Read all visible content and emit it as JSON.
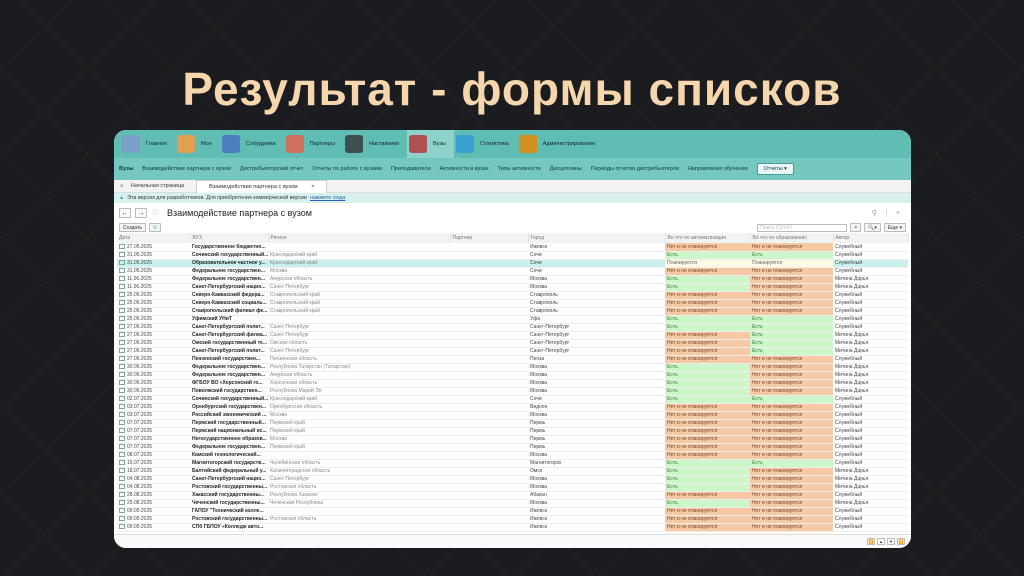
{
  "slide_title": "Результат - формы списков",
  "nav1": [
    {
      "label": "Главное",
      "color": "#7aa0c8"
    },
    {
      "label": "Мое",
      "color": "#e0a050"
    },
    {
      "label": "Сотрудники",
      "color": "#4a7fc0"
    },
    {
      "label": "Партнеры",
      "color": "#d07060"
    },
    {
      "label": "Наставники",
      "color": "#405050"
    },
    {
      "label": "Вузы",
      "color": "#b05050",
      "active": true
    },
    {
      "label": "Статистика",
      "color": "#3aa0d0"
    },
    {
      "label": "Администрирование",
      "color": "#d09020"
    }
  ],
  "nav2": {
    "section": "Вузы",
    "items": [
      "Взаимодействие партнера с вузом",
      "Дистрибьюторский отчет",
      "Отчеты по работе с вузами",
      "Преподаватели",
      "Активности в вузах",
      "Типы активности",
      "Дисциплины",
      "Периоды отчетов дистрибьютеров",
      "Направления обучения"
    ],
    "reports": "Отчеты ▾"
  },
  "tabs": {
    "home": "Начальная страница",
    "current": "Взаимодействие партнера с вузом"
  },
  "info": {
    "text": "Эта версия для разработчиков. Для приобретения коммерческой версии",
    "link": "нажмите сюда"
  },
  "form": {
    "title": "Взаимодействие партнера с вузом",
    "create": "Создать",
    "search_placeholder": "Поиск (Ctrl+F)",
    "more": "Еще ▾"
  },
  "columns": [
    "Дата",
    "ВУЗ",
    "Регион",
    "Партнер",
    "Город",
    "Во что по автоматизации",
    "Во что по образованию",
    "Автор"
  ],
  "status": {
    "N": "Нет и не планируется",
    "Y": "Есть",
    "P": "Планируется"
  },
  "rows": [
    [
      "27.05.2025",
      "Государственное бюджетно...",
      "",
      "",
      "Ижевск",
      "N",
      "N",
      "Служебный"
    ],
    [
      "31.05.2025",
      "Сочинский государственный...",
      "Краснодарский край",
      "",
      "Сочи",
      "Y",
      "Y",
      "Служебный"
    ],
    [
      "31.05.2025",
      "Образовательное частное у...",
      "Краснодарский край",
      "",
      "Сочи",
      "P",
      "P",
      "Служебный"
    ],
    [
      "31.05.2025",
      "Федеральное государствен...",
      "Москва",
      "",
      "Сочи",
      "N",
      "N",
      "Служебный"
    ],
    [
      "11.06.2025",
      "Федеральное государствен...",
      "Амурская область",
      "",
      "Москва",
      "Y",
      "N",
      "Митина Дарья"
    ],
    [
      "11.06.2025",
      "Санкт-Петербургский нацио...",
      "Санкт-Петербург",
      "",
      "Москва",
      "Y",
      "N",
      "Митина Дарья"
    ],
    [
      "25.06.2025",
      "Северо-Кавказский федера...",
      "Ставропольский край",
      "",
      "Ставрополь",
      "N",
      "N",
      "Служебный"
    ],
    [
      "25.06.2025",
      "Северо-Кавказский социаль...",
      "Ставропольский край",
      "",
      "Ставрополь",
      "N",
      "N",
      "Служебный"
    ],
    [
      "25.06.2025",
      "Ставропольский филиал фе...",
      "Ставропольский край",
      "",
      "Ставрополь",
      "N",
      "N",
      "Служебный"
    ],
    [
      "25.06.2025",
      "Уфимский УНиТ",
      "",
      "",
      "Уфа",
      "Y",
      "Y",
      "Служебный"
    ],
    [
      "27.06.2025",
      "Санкт-Петербургский полит...",
      "Санкт-Петербург",
      "",
      "Санкт-Петербург",
      "Y",
      "Y",
      "Служебный"
    ],
    [
      "27.06.2025",
      "Санкт-Петербургский филиа...",
      "Санкт-Петербург",
      "",
      "Санкт-Петербург",
      "N",
      "Y",
      "Митина Дарья"
    ],
    [
      "27.06.2025",
      "Омский государственный те...",
      "Омская область",
      "",
      "Санкт-Петербург",
      "N",
      "Y",
      "Митина Дарья"
    ],
    [
      "27.06.2025",
      "Санкт-Петербургский полит...",
      "Санкт-Петербург",
      "",
      "Санкт-Петербург",
      "N",
      "Y",
      "Митина Дарья"
    ],
    [
      "27.06.2025",
      "Пензенский государствен...",
      "Пензенская область",
      "",
      "Пенза",
      "N",
      "N",
      "Служебный"
    ],
    [
      "30.06.2025",
      "Федеральное государствен...",
      "Республика Татарстан (Татарстан)",
      "",
      "Москва",
      "Y",
      "N",
      "Митина Дарья"
    ],
    [
      "30.06.2025",
      "Федеральное государствен...",
      "Амурская область",
      "",
      "Москва",
      "Y",
      "N",
      "Митина Дарья"
    ],
    [
      "30.06.2025",
      "ФГБОУ ВО «Херсонский го...",
      "Херсонская область",
      "",
      "Москва",
      "Y",
      "N",
      "Митина Дарья"
    ],
    [
      "30.06.2025",
      "Поволжский государствен...",
      "Республика Марий Эл",
      "",
      "Москва",
      "Y",
      "N",
      "Митина Дарья"
    ],
    [
      "02.07.2025",
      "Сочинский государственный...",
      "Краснодарский край",
      "",
      "Сочи",
      "Y",
      "Y",
      "Служебный"
    ],
    [
      "03.07.2025",
      "Оренбургский государствен...",
      "Оренбургская область",
      "",
      "Видное",
      "N",
      "N",
      "Служебный"
    ],
    [
      "03.07.2025",
      "Российский экономический ...",
      "Москва",
      "",
      "Москва",
      "N",
      "N",
      "Служебный"
    ],
    [
      "07.07.2025",
      "Пермский государственный...",
      "Пермский край",
      "",
      "Пермь",
      "N",
      "N",
      "Служебный"
    ],
    [
      "07.07.2025",
      "Пермский национальный ис...",
      "Пермский край",
      "",
      "Пермь",
      "N",
      "N",
      "Служебный"
    ],
    [
      "07.07.2025",
      "Негосударственное образов...",
      "Москва",
      "",
      "Пермь",
      "N",
      "N",
      "Служебный"
    ],
    [
      "07.07.2025",
      "Федеральное государствен...",
      "Пермский край",
      "",
      "Пермь",
      "N",
      "N",
      "Служебный"
    ],
    [
      "08.07.2025",
      "Камский технологический...",
      "",
      "",
      "Москва",
      "N",
      "N",
      "Служебный"
    ],
    [
      "15.07.2025",
      "Магнитогорский государств...",
      "Челябинская область",
      "",
      "Магнитогорск",
      "Y",
      "Y",
      "Служебный"
    ],
    [
      "18.07.2025",
      "Балтийский федеральный у...",
      "Калининградская область",
      "",
      "Омск",
      "Y",
      "N",
      "Митина Дарья"
    ],
    [
      "04.08.2025",
      "Санкт-Петербургский нацио...",
      "Санкт-Петербург",
      "",
      "Москва",
      "Y",
      "N",
      "Митина Дарья"
    ],
    [
      "04.08.2025",
      "Ростовский государственны...",
      "Ростовская область",
      "",
      "Москва",
      "Y",
      "N",
      "Митина Дарья"
    ],
    [
      "28.08.2025",
      "Хакасский государственны...",
      "Республика Хакасия",
      "",
      "Абакан",
      "N",
      "N",
      "Служебный"
    ],
    [
      "29.08.2025",
      "Чеченский государственны...",
      "Чеченская Республика",
      "",
      "Москва",
      "Y",
      "N",
      "Митина Дарья"
    ],
    [
      "09.09.2025",
      "ГАПОУ \"Технический колле...",
      "",
      "",
      "Ижевск",
      "N",
      "N",
      "Служебный"
    ],
    [
      "09.09.2025",
      "Ростовский государственны...",
      "Ростовская область",
      "",
      "Ижевск",
      "N",
      "N",
      "Служебный"
    ],
    [
      "09.09.2025",
      "СПб ГБПОУ «Колледж авто...",
      "",
      "",
      "Ижевск",
      "N",
      "N",
      "Служебный"
    ]
  ],
  "selected_row": 2
}
